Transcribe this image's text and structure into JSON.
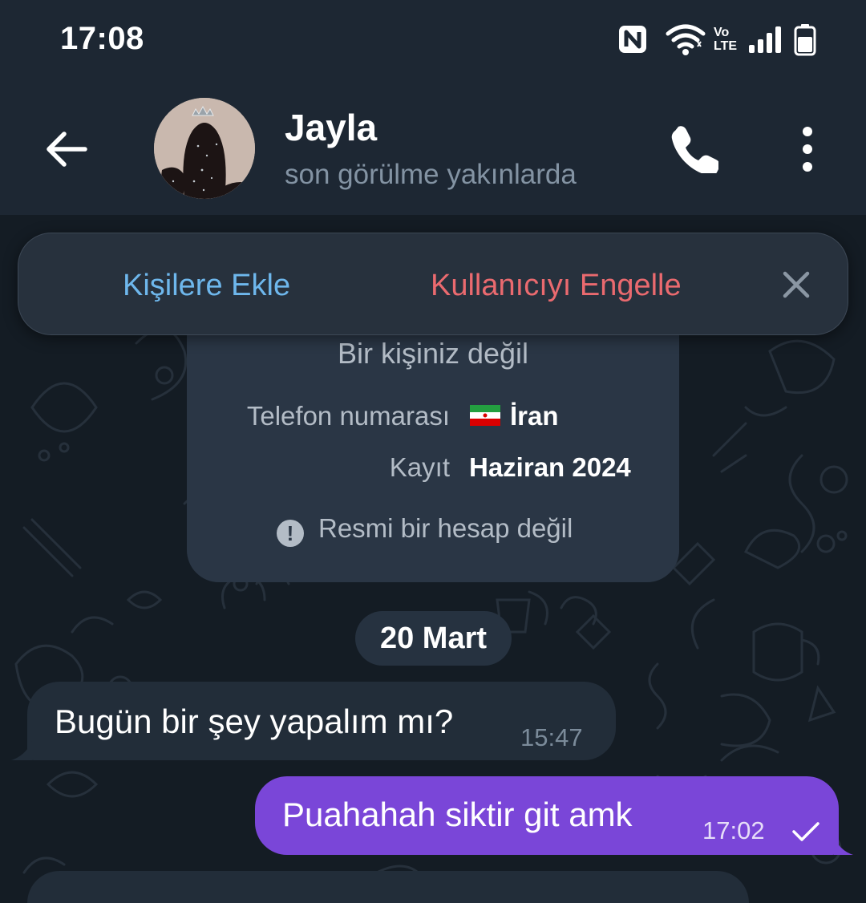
{
  "status_bar": {
    "time": "17:08",
    "icons": [
      "nfc-icon",
      "wifi-icon",
      "volte-icon",
      "signal-icon",
      "battery-icon"
    ],
    "volte_label": "Vo LTE"
  },
  "header": {
    "name": "Jayla",
    "last_seen": "son görülme yakınlarda"
  },
  "action_bar": {
    "add_contact": "Kişilere Ekle",
    "block_user": "Kullanıcıyı Engelle"
  },
  "info_card": {
    "title": "Bir kişiniz değil",
    "phone_label": "Telefon numarası",
    "phone_value": "İran",
    "registered_label": "Kayıt",
    "registered_value": "Haziran 2024",
    "official_note": "Resmi bir hesap değil"
  },
  "date_separator": "20 Mart",
  "messages": [
    {
      "direction": "incoming",
      "text": "Bugün bir şey yapalım mı?",
      "time": "15:47"
    },
    {
      "direction": "outgoing",
      "text": "Puahahah siktir git amk",
      "time": "17:02",
      "status": "sent"
    }
  ],
  "colors": {
    "background": "#141c24",
    "header": "#1d2733",
    "accent_blue": "#6eb7ec",
    "accent_red": "#ea6a6f",
    "outgoing_bubble": "#7a46d8",
    "incoming_bubble": "#222d39"
  }
}
